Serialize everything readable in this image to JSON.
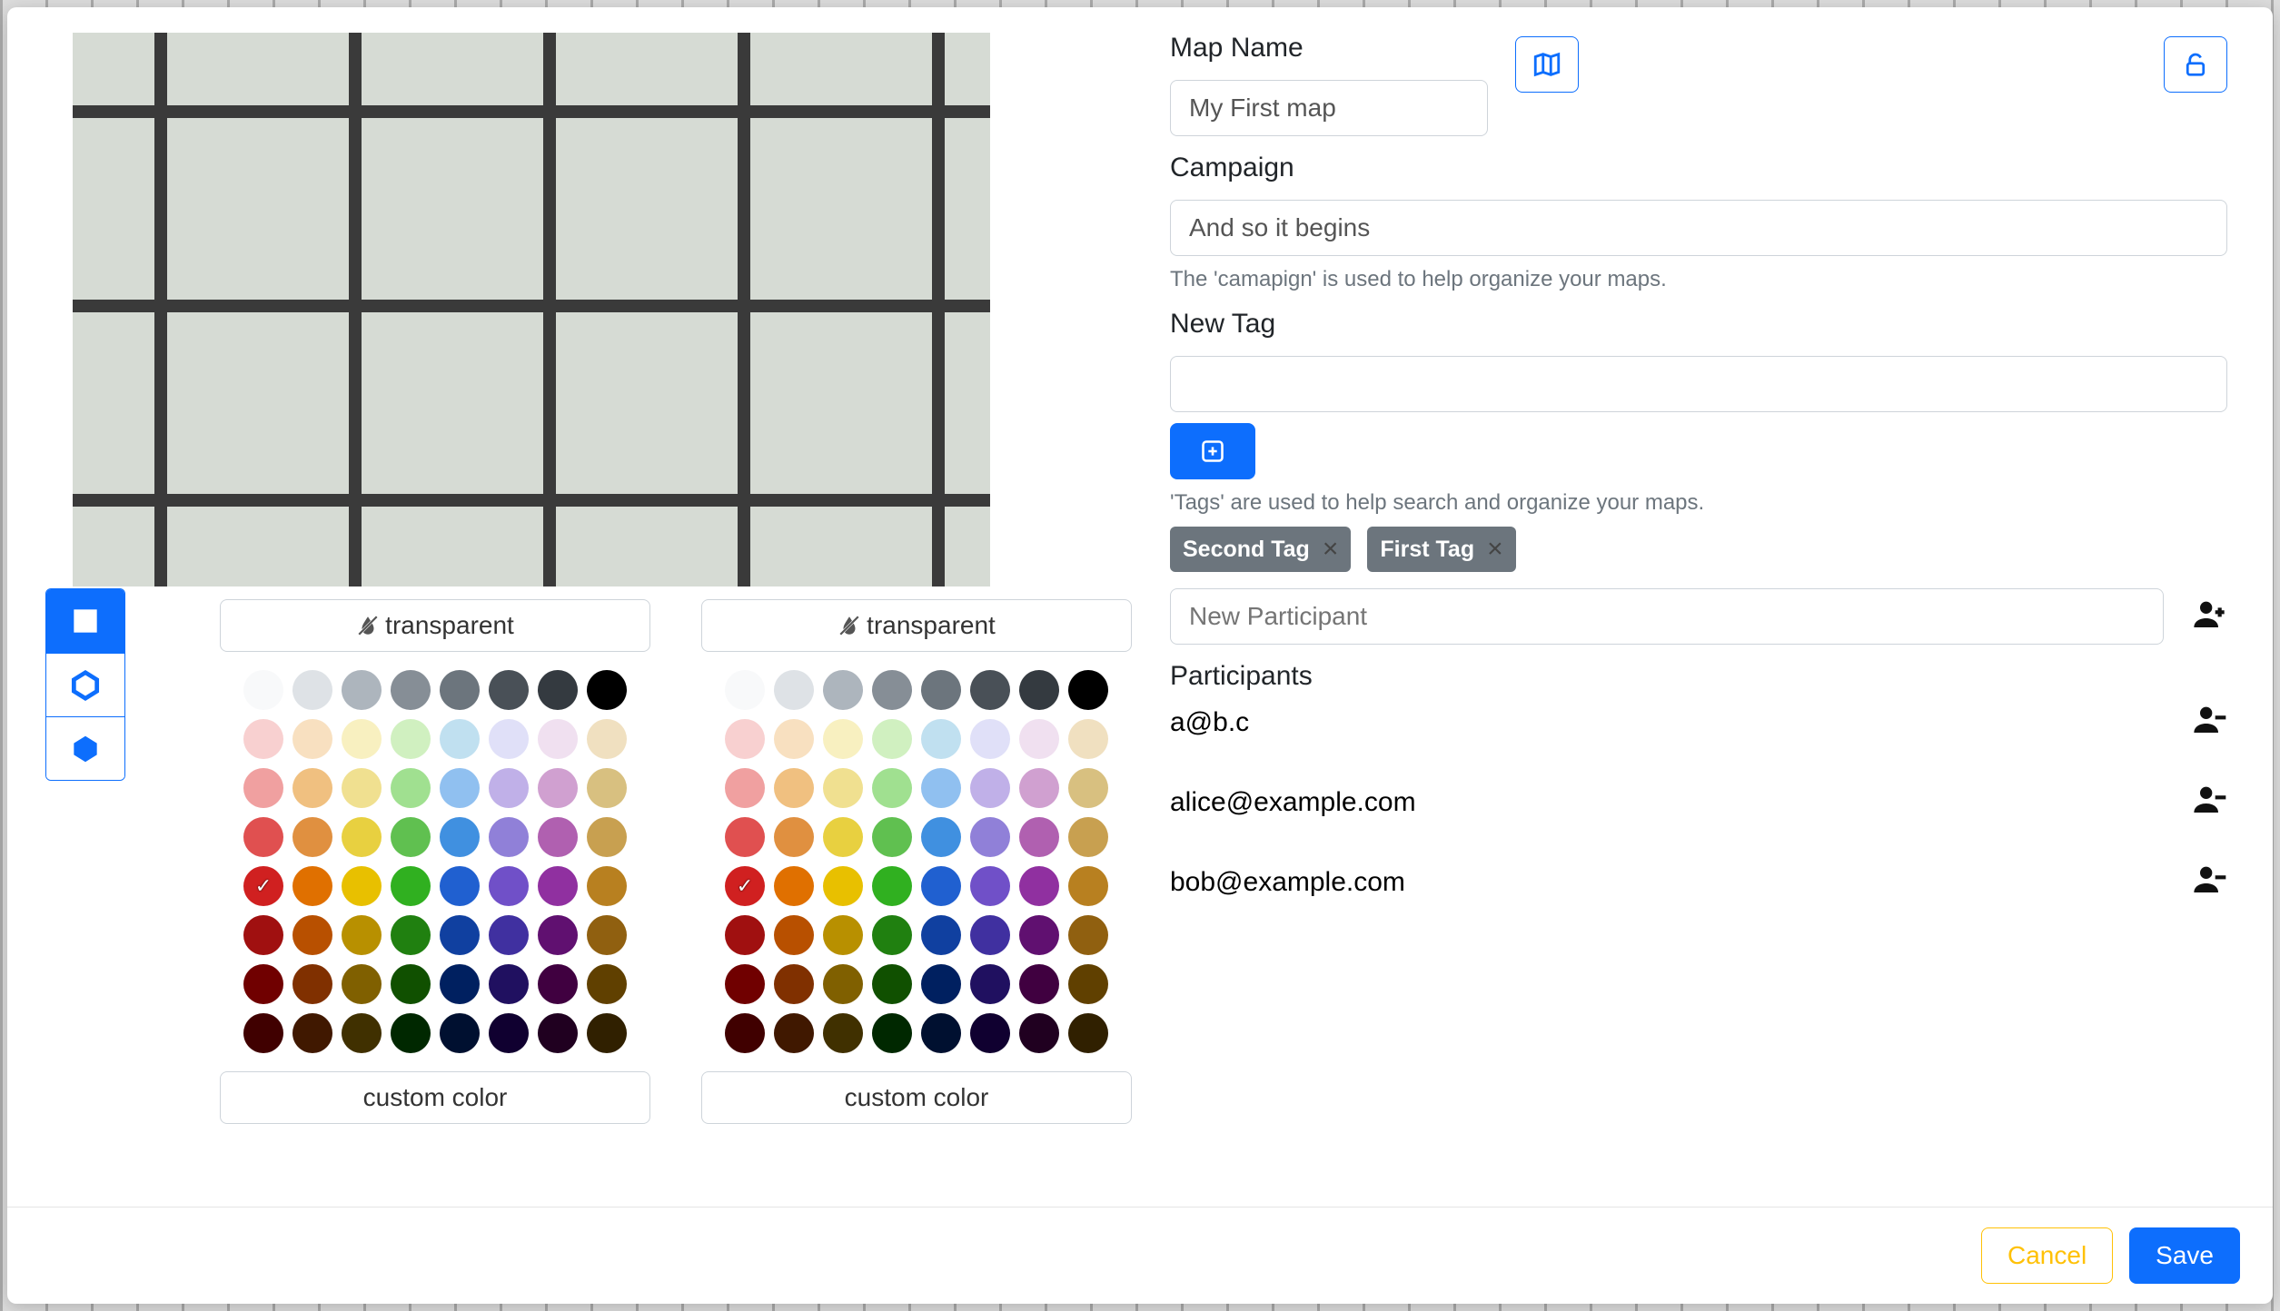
{
  "form": {
    "map_name_label": "Map Name",
    "map_name_value": "My First map",
    "campaign_label": "Campaign",
    "campaign_value": "And so it begins",
    "campaign_help": "The 'camapign' is used to help organize your maps.",
    "new_tag_label": "New Tag",
    "new_tag_value": "",
    "tags_help": "'Tags' are used to help search and organize your maps.",
    "tags": [
      "Second Tag",
      "First Tag"
    ],
    "new_participant_placeholder": "New Participant",
    "participants_label": "Participants",
    "participants": [
      "a@b.c",
      "alice@example.com",
      "bob@example.com"
    ]
  },
  "palette": {
    "transparent_label": "transparent",
    "custom_label": "custom color",
    "rows": [
      [
        "#f8f9fa",
        "#dee2e6",
        "#adb5bd",
        "#868e96",
        "#6c757d",
        "#495057",
        "#343a40",
        "#000000"
      ],
      [
        "#f8d0d0",
        "#f8e0c0",
        "#f8f0c0",
        "#d0f0c0",
        "#c0e0f0",
        "#e0e0f8",
        "#f0e0f0",
        "#f0e0c0"
      ],
      [
        "#f0a0a0",
        "#f0c080",
        "#f0e090",
        "#a0e090",
        "#90c0f0",
        "#c0b0e8",
        "#d0a0d0",
        "#d8c080"
      ],
      [
        "#e05050",
        "#e09040",
        "#e8d040",
        "#60c050",
        "#4090e0",
        "#9080d8",
        "#b060b0",
        "#c8a050"
      ],
      [
        "#d02020",
        "#e07000",
        "#e8c000",
        "#30b020",
        "#2060d0",
        "#7050c8",
        "#9030a0",
        "#b88020"
      ],
      [
        "#a01010",
        "#b85000",
        "#b89000",
        "#208010",
        "#1040a0",
        "#4030a0",
        "#601070",
        "#906010"
      ],
      [
        "#700000",
        "#803000",
        "#806000",
        "#105000",
        "#002060",
        "#201060",
        "#400040",
        "#604000"
      ],
      [
        "#400000",
        "#401800",
        "#403000",
        "#002800",
        "#001030",
        "#100030",
        "#200020",
        "#302000"
      ]
    ],
    "selected_index": [
      4,
      0
    ]
  },
  "footer": {
    "cancel": "Cancel",
    "save": "Save"
  },
  "icons": {
    "map": "map-icon",
    "unlock": "unlock-icon",
    "plus": "plus-icon",
    "droplet_slash": "droplet-slash-icon",
    "user_add": "person-plus-icon",
    "user_remove": "person-minus-icon"
  }
}
